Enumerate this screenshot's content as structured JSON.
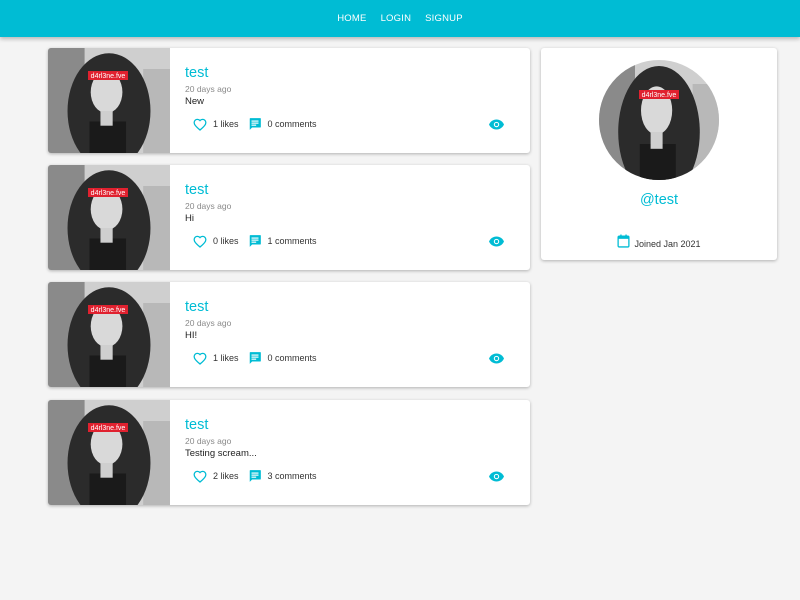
{
  "nav": {
    "items": [
      "HOME",
      "LOGIN",
      "SIGNUP"
    ]
  },
  "accent_color": "#00bcd4",
  "watermark_text": "d4rl3ne.fve",
  "posts": [
    {
      "title": "test",
      "time": "20 days ago",
      "body": "New",
      "likes_label": "1 likes",
      "comments_label": "0 comments"
    },
    {
      "title": "test",
      "time": "20 days ago",
      "body": "Hi",
      "likes_label": "0 likes",
      "comments_label": "1 comments"
    },
    {
      "title": "test",
      "time": "20 days ago",
      "body": "HI!",
      "likes_label": "1 likes",
      "comments_label": "0 comments"
    },
    {
      "title": "test",
      "time": "20 days ago",
      "body": "Testing scream...",
      "likes_label": "2 likes",
      "comments_label": "3 comments"
    }
  ],
  "profile": {
    "handle": "@test",
    "joined": "Joined Jan 2021",
    "icon": "calendar-icon"
  },
  "icons": {
    "like": "heart-outline-icon",
    "comment": "comment-icon",
    "view": "eye-icon"
  }
}
